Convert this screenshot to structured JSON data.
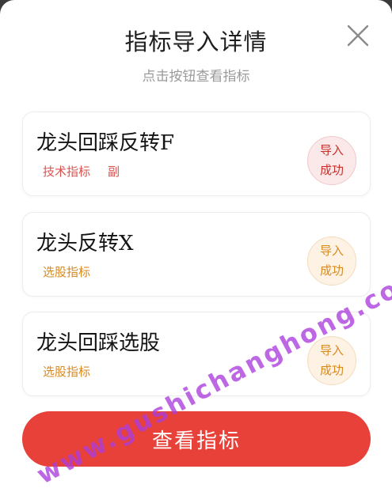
{
  "dialog": {
    "title": "指标导入详情",
    "subtitle": "点击按钮查看指标",
    "close_icon": "close-icon"
  },
  "items": [
    {
      "name": "龙头回踩反转F",
      "tags": [
        "技术指标",
        "副"
      ],
      "status_line1": "导入",
      "status_line2": "成功",
      "status_color": "#c9302c"
    },
    {
      "name": "龙头反转X",
      "tags": [
        "选股指标"
      ],
      "status_line1": "导入",
      "status_line2": "成功",
      "status_color": "#d98a1f"
    },
    {
      "name": "龙头回踩选股",
      "tags": [
        "选股指标"
      ],
      "status_line1": "导入",
      "status_line2": "成功",
      "status_color": "#d98a1f"
    }
  ],
  "footer": {
    "view_button_label": "查看指标"
  },
  "watermark": {
    "text": "www.gushichanghong.com"
  },
  "colors": {
    "accent": "#e8413a",
    "tag_red": "#d9534f",
    "tag_orange": "#d98a1f"
  }
}
